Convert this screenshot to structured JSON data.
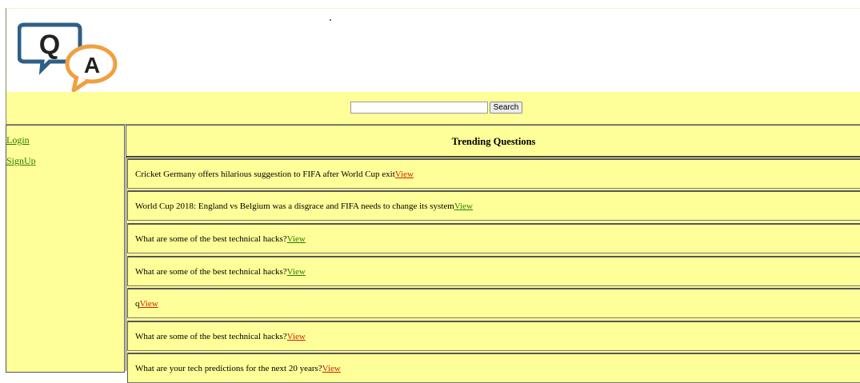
{
  "logo": {
    "q_letter": "Q",
    "a_letter": "A"
  },
  "search": {
    "value": "",
    "placeholder": "",
    "button_label": "Search"
  },
  "sidebar": {
    "links": [
      {
        "label": "Login"
      },
      {
        "label": "SignUp"
      }
    ]
  },
  "main": {
    "heading": "Trending Questions",
    "questions": [
      {
        "text": "Cricket Germany offers hilarious suggestion to FIFA after World Cup exit",
        "link": "View",
        "link_color": "#cc2200"
      },
      {
        "text": "World Cup 2018: England vs Belgium was a disgrace and FIFA needs to change its system",
        "link": "View",
        "link_color": "#2a7a00"
      },
      {
        "text": "What are some of the best technical hacks?",
        "link": "View",
        "link_color": "#2a7a00"
      },
      {
        "text": "What are some of the best technical hacks?",
        "link": "View",
        "link_color": "#2a7a00"
      },
      {
        "text": "q",
        "link": "View",
        "link_color": "#cc2200"
      },
      {
        "text": "What are some of the best technical hacks?",
        "link": "View",
        "link_color": "#cc2200"
      },
      {
        "text": "What are your tech predictions for the next 20 years?",
        "link": "View",
        "link_color": "#cc2200"
      }
    ]
  },
  "colors": {
    "page_background": "#ffff99",
    "header_background": "#ffffff",
    "logo_q_bubble": "#2f5f86",
    "logo_a_bubble": "#f0a040",
    "link_green": "#2a7a00",
    "link_red": "#cc2200"
  }
}
